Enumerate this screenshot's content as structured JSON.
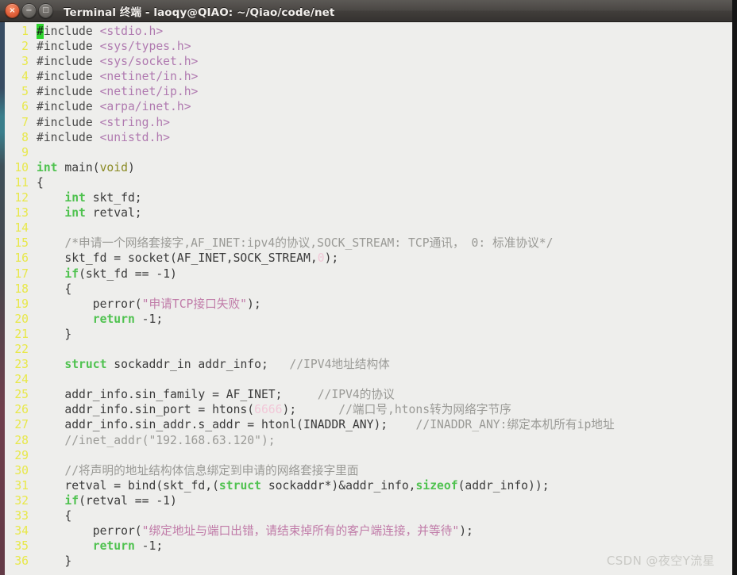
{
  "window": {
    "title": "Terminal 终端 - laoqy@QIAO: ~/Qiao/code/net",
    "buttons": {
      "close": "×",
      "minimize": "−",
      "maximize": "□"
    }
  },
  "colors": {
    "background": "#eeeeec",
    "titlebar": "#4a4744",
    "line_number": "#e8e84a",
    "keyword": "#4fc24f",
    "string": "#c07ba8",
    "comment": "#9a9a96",
    "header": "#b07ab0",
    "number": "#f2c8d8",
    "cursor": "#2bd32b"
  },
  "editor": {
    "first_line": 1,
    "last_line": 36,
    "cursor_line": 1,
    "cursor_column": 1,
    "lines": [
      {
        "n": "1",
        "tokens": [
          {
            "t": "#",
            "c": "cursor"
          },
          {
            "t": "include ",
            "c": "pre"
          },
          {
            "t": "<stdio.h>",
            "c": "hdr"
          }
        ]
      },
      {
        "n": "2",
        "tokens": [
          {
            "t": "#include ",
            "c": "pre"
          },
          {
            "t": "<sys/types.h>",
            "c": "hdr"
          }
        ]
      },
      {
        "n": "3",
        "tokens": [
          {
            "t": "#include ",
            "c": "pre"
          },
          {
            "t": "<sys/socket.h>",
            "c": "hdr"
          }
        ]
      },
      {
        "n": "4",
        "tokens": [
          {
            "t": "#include ",
            "c": "pre"
          },
          {
            "t": "<netinet/in.h>",
            "c": "hdr"
          }
        ]
      },
      {
        "n": "5",
        "tokens": [
          {
            "t": "#include ",
            "c": "pre"
          },
          {
            "t": "<netinet/ip.h>",
            "c": "hdr"
          }
        ]
      },
      {
        "n": "6",
        "tokens": [
          {
            "t": "#include ",
            "c": "pre"
          },
          {
            "t": "<arpa/inet.h>",
            "c": "hdr"
          }
        ]
      },
      {
        "n": "7",
        "tokens": [
          {
            "t": "#include ",
            "c": "pre"
          },
          {
            "t": "<string.h>",
            "c": "hdr"
          }
        ]
      },
      {
        "n": "8",
        "tokens": [
          {
            "t": "#include ",
            "c": "pre"
          },
          {
            "t": "<unistd.h>",
            "c": "hdr"
          }
        ]
      },
      {
        "n": "9",
        "tokens": []
      },
      {
        "n": "10",
        "tokens": [
          {
            "t": "int",
            "c": "kw"
          },
          {
            "t": " main(",
            "c": "plain"
          },
          {
            "t": "void",
            "c": "type"
          },
          {
            "t": ")",
            "c": "plain"
          }
        ]
      },
      {
        "n": "11",
        "tokens": [
          {
            "t": "{",
            "c": "plain"
          }
        ]
      },
      {
        "n": "12",
        "tokens": [
          {
            "t": "    ",
            "c": "plain"
          },
          {
            "t": "int",
            "c": "kw"
          },
          {
            "t": " skt_fd;",
            "c": "plain"
          }
        ]
      },
      {
        "n": "13",
        "tokens": [
          {
            "t": "    ",
            "c": "plain"
          },
          {
            "t": "int",
            "c": "kw"
          },
          {
            "t": " retval;",
            "c": "plain"
          }
        ]
      },
      {
        "n": "14",
        "tokens": []
      },
      {
        "n": "15",
        "tokens": [
          {
            "t": "    ",
            "c": "plain"
          },
          {
            "t": "/*申请一个网络套接字,AF_INET:ipv4的协议,SOCK_STREAM: TCP通讯， 0: 标准协议*/",
            "c": "cmt"
          }
        ]
      },
      {
        "n": "16",
        "tokens": [
          {
            "t": "    skt_fd = socket(AF_INET,SOCK_STREAM,",
            "c": "plain"
          },
          {
            "t": "0",
            "c": "num"
          },
          {
            "t": ");",
            "c": "plain"
          }
        ]
      },
      {
        "n": "17",
        "tokens": [
          {
            "t": "    ",
            "c": "plain"
          },
          {
            "t": "if",
            "c": "kw"
          },
          {
            "t": "(skt_fd == -",
            "c": "plain"
          },
          {
            "t": "1",
            "c": "plain"
          },
          {
            "t": ")",
            "c": "plain"
          }
        ]
      },
      {
        "n": "18",
        "tokens": [
          {
            "t": "    {",
            "c": "plain"
          }
        ]
      },
      {
        "n": "19",
        "tokens": [
          {
            "t": "        perror(",
            "c": "plain"
          },
          {
            "t": "\"申请TCP接口失败\"",
            "c": "str"
          },
          {
            "t": ");",
            "c": "plain"
          }
        ]
      },
      {
        "n": "20",
        "tokens": [
          {
            "t": "        ",
            "c": "plain"
          },
          {
            "t": "return",
            "c": "kw"
          },
          {
            "t": " -1;",
            "c": "plain"
          }
        ]
      },
      {
        "n": "21",
        "tokens": [
          {
            "t": "    }",
            "c": "plain"
          }
        ]
      },
      {
        "n": "22",
        "tokens": []
      },
      {
        "n": "23",
        "tokens": [
          {
            "t": "    ",
            "c": "plain"
          },
          {
            "t": "struct",
            "c": "kw"
          },
          {
            "t": " sockaddr_in addr_info;   ",
            "c": "plain"
          },
          {
            "t": "//IPV4地址结构体",
            "c": "cmt"
          }
        ]
      },
      {
        "n": "24",
        "tokens": []
      },
      {
        "n": "25",
        "tokens": [
          {
            "t": "    addr_info.sin_family = AF_INET;     ",
            "c": "plain"
          },
          {
            "t": "//IPV4的协议",
            "c": "cmt"
          }
        ]
      },
      {
        "n": "26",
        "tokens": [
          {
            "t": "    addr_info.sin_port = htons(",
            "c": "plain"
          },
          {
            "t": "6666",
            "c": "num"
          },
          {
            "t": ");      ",
            "c": "plain"
          },
          {
            "t": "//端口号,htons转为网络字节序",
            "c": "cmt"
          }
        ]
      },
      {
        "n": "27",
        "tokens": [
          {
            "t": "    addr_info.sin_addr.s_addr = htonl(INADDR_ANY);    ",
            "c": "plain"
          },
          {
            "t": "//INADDR_ANY:绑定本机所有ip地址",
            "c": "cmt"
          }
        ]
      },
      {
        "n": "28",
        "tokens": [
          {
            "t": "    ",
            "c": "plain"
          },
          {
            "t": "//inet_addr(\"192.168.63.120\");",
            "c": "cmt"
          }
        ]
      },
      {
        "n": "29",
        "tokens": []
      },
      {
        "n": "30",
        "tokens": [
          {
            "t": "    ",
            "c": "plain"
          },
          {
            "t": "//将声明的地址结构体信息绑定到申请的网络套接字里面",
            "c": "cmt"
          }
        ]
      },
      {
        "n": "31",
        "tokens": [
          {
            "t": "    retval = bind(skt_fd,(",
            "c": "plain"
          },
          {
            "t": "struct",
            "c": "kw"
          },
          {
            "t": " sockaddr*)&addr_info,",
            "c": "plain"
          },
          {
            "t": "sizeof",
            "c": "kw"
          },
          {
            "t": "(addr_info));",
            "c": "plain"
          }
        ]
      },
      {
        "n": "32",
        "tokens": [
          {
            "t": "    ",
            "c": "plain"
          },
          {
            "t": "if",
            "c": "kw"
          },
          {
            "t": "(retval == -1)",
            "c": "plain"
          }
        ]
      },
      {
        "n": "33",
        "tokens": [
          {
            "t": "    {",
            "c": "plain"
          }
        ]
      },
      {
        "n": "34",
        "tokens": [
          {
            "t": "        perror(",
            "c": "plain"
          },
          {
            "t": "\"绑定地址与端口出错，请结束掉所有的客户端连接，并等待\"",
            "c": "str"
          },
          {
            "t": ");",
            "c": "plain"
          }
        ]
      },
      {
        "n": "35",
        "tokens": [
          {
            "t": "        ",
            "c": "plain"
          },
          {
            "t": "return",
            "c": "kw"
          },
          {
            "t": " -1;",
            "c": "plain"
          }
        ]
      },
      {
        "n": "36",
        "tokens": [
          {
            "t": "    }",
            "c": "plain"
          }
        ]
      }
    ]
  },
  "watermark": {
    "text": "CSDN @夜空Y流星"
  }
}
